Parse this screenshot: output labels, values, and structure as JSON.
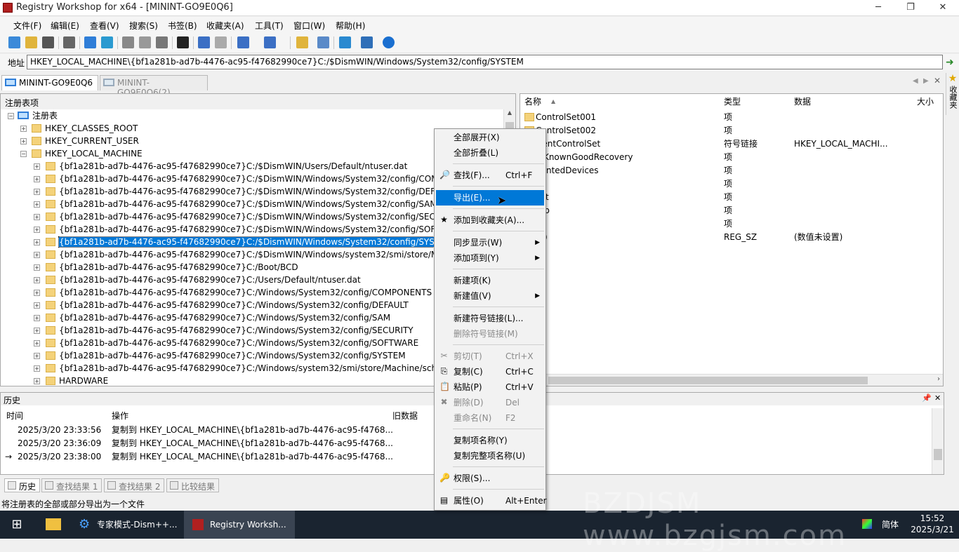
{
  "window": {
    "title": "Registry Workshop for x64 - [MININT-GO9E0Q6]",
    "min": "─",
    "max": "❐",
    "close": "✕"
  },
  "menu": [
    "文件(F)",
    "编辑(E)",
    "查看(V)",
    "搜索(S)",
    "书签(B)",
    "收藏夹(A)",
    "工具(T)",
    "窗口(W)",
    "帮助(H)"
  ],
  "address": {
    "label": "地址",
    "value": "HKEY_LOCAL_MACHINE\\{bf1a281b-ad7b-4476-ac95-f47682990ce7}C:/$DismWIN/Windows/System32/config/SYSTEM"
  },
  "tabs": [
    "MININT-GO9E0Q6",
    "MININT-GO9E0Q6(2)"
  ],
  "tree": {
    "header": "注册表项",
    "root": "注册表",
    "hives": [
      "HKEY_CLASSES_ROOT",
      "HKEY_CURRENT_USER",
      "HKEY_LOCAL_MACHINE"
    ],
    "children": [
      "{bf1a281b-ad7b-4476-ac95-f47682990ce7}C:/$DismWIN/Users/Default/ntuser.dat",
      "{bf1a281b-ad7b-4476-ac95-f47682990ce7}C:/$DismWIN/Windows/System32/config/COMPO",
      "{bf1a281b-ad7b-4476-ac95-f47682990ce7}C:/$DismWIN/Windows/System32/config/DEFAUL",
      "{bf1a281b-ad7b-4476-ac95-f47682990ce7}C:/$DismWIN/Windows/System32/config/SAM",
      "{bf1a281b-ad7b-4476-ac95-f47682990ce7}C:/$DismWIN/Windows/System32/config/SECURI",
      "{bf1a281b-ad7b-4476-ac95-f47682990ce7}C:/$DismWIN/Windows/System32/config/SOFTW",
      "{bf1a281b-ad7b-4476-ac95-f47682990ce7}C:/$DismWIN/Windows/System32/config/SYSTEM",
      "{bf1a281b-ad7b-4476-ac95-f47682990ce7}C:/$DismWIN/Windows/system32/smi/store/Mac",
      "{bf1a281b-ad7b-4476-ac95-f47682990ce7}C:/Boot/BCD",
      "{bf1a281b-ad7b-4476-ac95-f47682990ce7}C:/Users/Default/ntuser.dat",
      "{bf1a281b-ad7b-4476-ac95-f47682990ce7}C:/Windows/System32/config/COMPONENTS",
      "{bf1a281b-ad7b-4476-ac95-f47682990ce7}C:/Windows/System32/config/DEFAULT",
      "{bf1a281b-ad7b-4476-ac95-f47682990ce7}C:/Windows/System32/config/SAM",
      "{bf1a281b-ad7b-4476-ac95-f47682990ce7}C:/Windows/System32/config/SECURITY",
      "{bf1a281b-ad7b-4476-ac95-f47682990ce7}C:/Windows/System32/config/SOFTWARE",
      "{bf1a281b-ad7b-4476-ac95-f47682990ce7}C:/Windows/System32/config/SYSTEM",
      "{bf1a281b-ad7b-4476-ac95-f47682990ce7}C:/Windows/system32/smi/store/Machine/schema",
      "HARDWARE"
    ],
    "selected_index": 6
  },
  "list": {
    "headers": {
      "name": "名称",
      "type": "类型",
      "data": "数据",
      "size": "大小"
    },
    "rows": [
      {
        "name": "ControlSet001",
        "type": "项",
        "data": ""
      },
      {
        "name": "ControlSet002",
        "type": "项",
        "data": ""
      },
      {
        "name": "rrentControlSet",
        "type": "符号链接",
        "data": "HKEY_LOCAL_MACHI..."
      },
      {
        "name": "stKnownGoodRecovery",
        "type": "项",
        "data": ""
      },
      {
        "name": "ountedDevices",
        "type": "项",
        "data": ""
      },
      {
        "name": "G",
        "type": "项",
        "data": ""
      },
      {
        "name": "ect",
        "type": "项",
        "data": ""
      },
      {
        "name": "tup",
        "type": "项",
        "data": ""
      },
      {
        "name": "PA",
        "type": "项",
        "data": ""
      },
      {
        "name": "认)",
        "type": "REG_SZ",
        "data": "(数值未设置)"
      }
    ]
  },
  "rightbar": {
    "label": "收藏夹"
  },
  "history": {
    "title": "历史",
    "headers": {
      "time": "时间",
      "op": "操作",
      "old": "旧数据"
    },
    "rows": [
      {
        "time": "2025/3/20 23:33:56",
        "op": "复制到 HKEY_LOCAL_MACHINE\\{bf1a281b-ad7b-4476-ac95-f4768..."
      },
      {
        "time": "2025/3/20 23:36:09",
        "op": "复制到 HKEY_LOCAL_MACHINE\\{bf1a281b-ad7b-4476-ac95-f4768..."
      },
      {
        "time": "2025/3/20 23:38:00",
        "op": "复制到 HKEY_LOCAL_MACHINE\\{bf1a281b-ad7b-4476-ac95-f4768..."
      }
    ]
  },
  "bottom_tabs": [
    "历史",
    "查找结果 1",
    "查找结果 2",
    "比较结果"
  ],
  "status": "将注册表的全部或部分导出为一个文件",
  "context_menu": [
    {
      "label": "全部展开(X)"
    },
    {
      "label": "全部折叠(L)"
    },
    {
      "sep": true
    },
    {
      "label": "查找(F)...",
      "shortcut": "Ctrl+F",
      "icon": "🔎"
    },
    {
      "sep": true
    },
    {
      "label": "导出(E)...",
      "highlight": true
    },
    {
      "sep": true
    },
    {
      "label": "添加到收藏夹(A)...",
      "icon": "★"
    },
    {
      "sep": true
    },
    {
      "label": "同步显示(W)",
      "submenu": true
    },
    {
      "label": "添加项到(Y)",
      "submenu": true
    },
    {
      "sep": true
    },
    {
      "label": "新建项(K)"
    },
    {
      "label": "新建值(V)",
      "submenu": true
    },
    {
      "sep": true
    },
    {
      "label": "新建符号链接(L)..."
    },
    {
      "label": "删除符号链接(M)",
      "disabled": true
    },
    {
      "sep": true
    },
    {
      "label": "剪切(T)",
      "shortcut": "Ctrl+X",
      "disabled": true,
      "icon": "✂"
    },
    {
      "label": "复制(C)",
      "shortcut": "Ctrl+C",
      "icon": "⎘"
    },
    {
      "label": "粘贴(P)",
      "shortcut": "Ctrl+V",
      "icon": "📋"
    },
    {
      "label": "删除(D)",
      "shortcut": "Del",
      "disabled": true,
      "icon": "✖"
    },
    {
      "label": "重命名(N)",
      "shortcut": "F2",
      "disabled": true
    },
    {
      "sep": true
    },
    {
      "label": "复制项名称(Y)"
    },
    {
      "label": "复制完整项名称(U)"
    },
    {
      "sep": true
    },
    {
      "label": "权限(S)...",
      "icon": "🔑"
    },
    {
      "sep": true
    },
    {
      "label": "属性(O)",
      "shortcut": "Alt+Enter",
      "icon": "▤"
    }
  ],
  "taskbar": {
    "items": [
      "专家模式-Dism++...",
      "Registry Worksh..."
    ],
    "ime": "简体",
    "time": "15:52",
    "date": "2025/3/21"
  },
  "watermark": "BZDJSM www.bzgjsm.com"
}
